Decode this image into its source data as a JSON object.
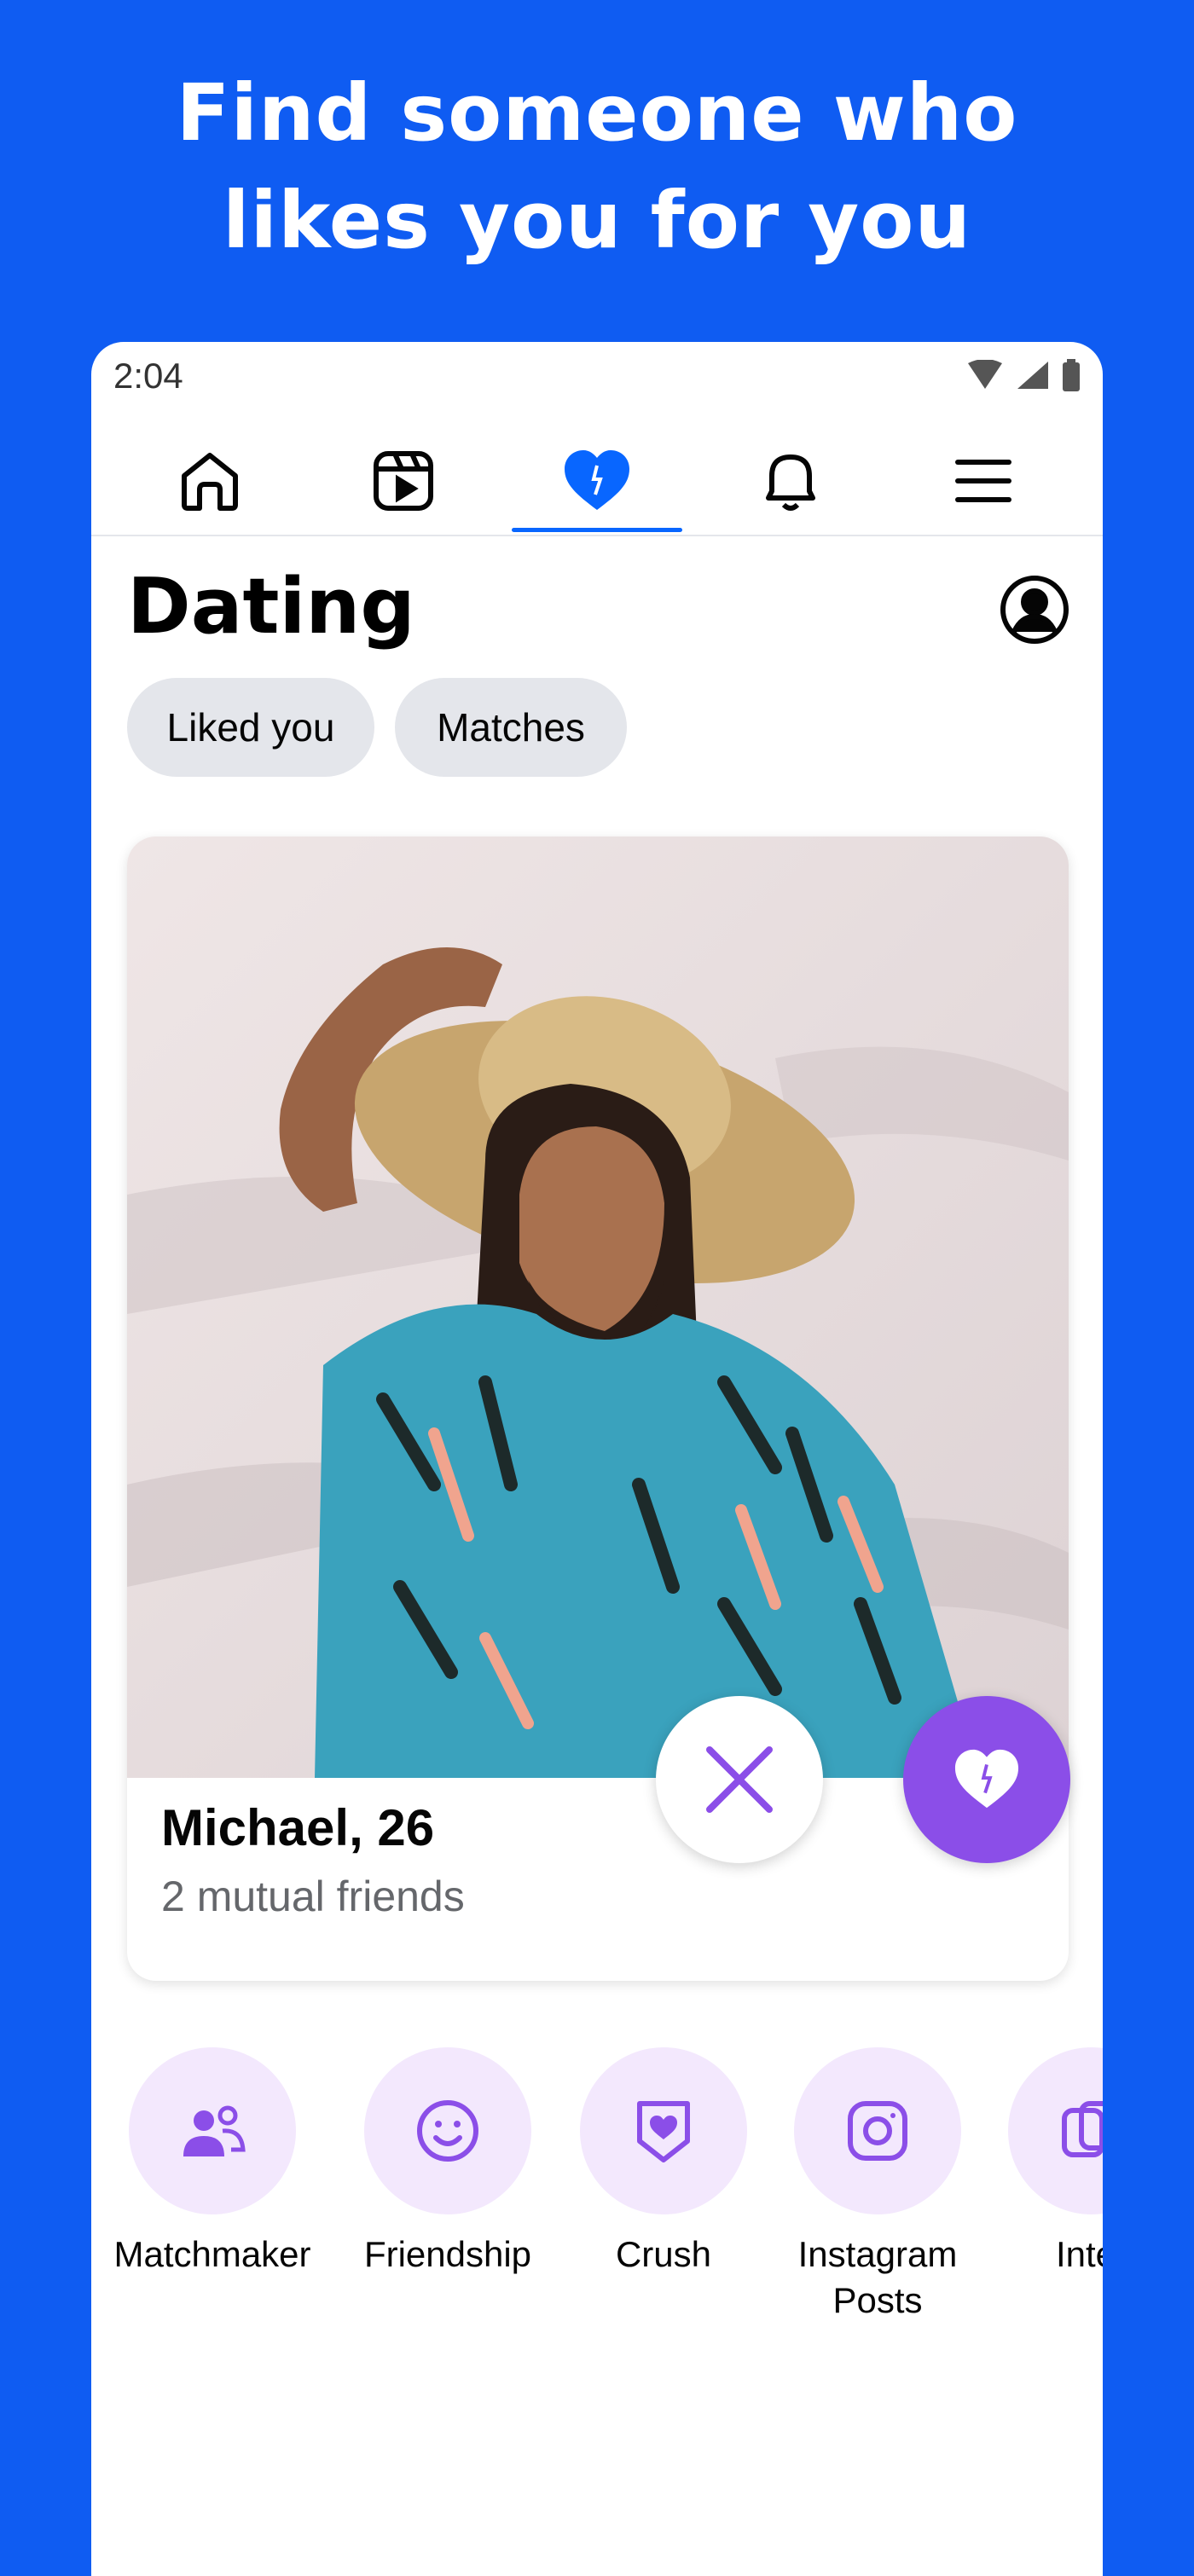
{
  "promo": {
    "headline_line1": "Find someone who",
    "headline_line2": "likes you for you"
  },
  "status_bar": {
    "time": "2:04",
    "icons": [
      "wifi-icon",
      "signal-icon",
      "battery-icon"
    ]
  },
  "nav": {
    "items": [
      {
        "icon": "home-icon",
        "active": false
      },
      {
        "icon": "video-icon",
        "active": false
      },
      {
        "icon": "heart-icon",
        "active": true
      },
      {
        "icon": "bell-icon",
        "active": false
      },
      {
        "icon": "menu-icon",
        "active": false
      }
    ],
    "active_color": "#0866ff"
  },
  "page": {
    "title": "Dating",
    "profile_icon": "profile-icon"
  },
  "chips": [
    "Liked you",
    "Matches"
  ],
  "profile_card": {
    "name": "Michael, 26",
    "mutual_friends": "2 mutual friends",
    "pass_icon": "close-icon",
    "like_icon": "heart-icon",
    "like_color": "#8b4ee8"
  },
  "features": [
    {
      "label": "Matchmaker",
      "icon": "people-icon"
    },
    {
      "label": "Friendship",
      "icon": "smiley-icon"
    },
    {
      "label": "Crush",
      "icon": "heart-badge-icon"
    },
    {
      "label": "Instagram\nPosts",
      "icon": "instagram-icon"
    },
    {
      "label": "Inter",
      "icon": "interests-icon"
    }
  ],
  "colors": {
    "background": "#0f5cf2",
    "accent_purple": "#8b4ee8",
    "chip_bg": "#e4e6eb"
  }
}
